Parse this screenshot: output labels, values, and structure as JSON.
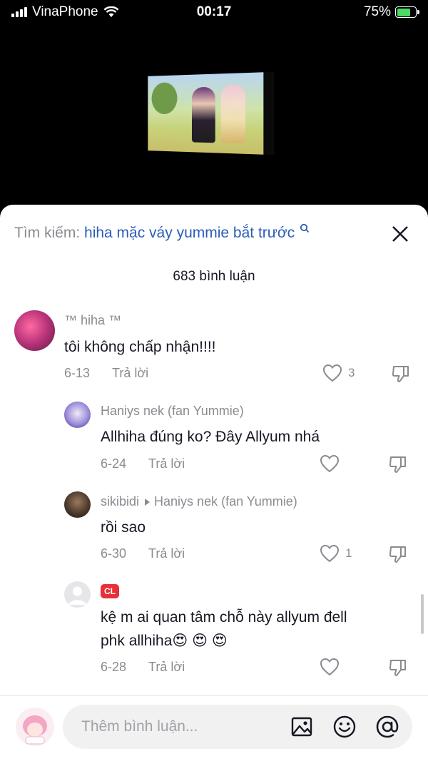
{
  "status_bar": {
    "carrier": "VinaPhone",
    "time": "00:17",
    "battery_percent": "75%",
    "battery_level": 0.75,
    "battery_color": "#4cd964"
  },
  "search": {
    "label": "Tìm kiếm:",
    "query": "hiha mặc váy yummie bắt trước",
    "icon": "search-icon"
  },
  "comments_count": "683 bình luận",
  "comments": [
    {
      "author": "™ hiha ™",
      "text": "tôi không chấp nhận!!!!",
      "date": "6-13",
      "reply": "Trả lời",
      "likes": "3"
    },
    {
      "author": "Haniys nek (fan Yummie)",
      "text": "Allhiha đúng ko? Đây Allyum nhá",
      "date": "6-24",
      "reply": "Trả lời",
      "likes": ""
    },
    {
      "author": "sikibidi",
      "reply_to": "Haniys nek (fan Yummie)",
      "text": "rồi sao",
      "date": "6-30",
      "reply": "Trả lời",
      "likes": "1"
    },
    {
      "author_badge": "CL",
      "text_line1": "kệ m ai quan tâm chỗ này allyum đell",
      "text_line2": "phk allhiha",
      "emojis": "😍 😍 😍",
      "date": "6-28",
      "reply": "Trả lời",
      "likes": ""
    }
  ],
  "composer": {
    "placeholder": "Thêm bình luận...",
    "icons": [
      "image-icon",
      "emoji-icon",
      "mention-icon"
    ]
  },
  "colors": {
    "accent_link": "#2b5db8",
    "muted": "#8a8b91",
    "text": "#161823",
    "badge": "#e8303a"
  }
}
